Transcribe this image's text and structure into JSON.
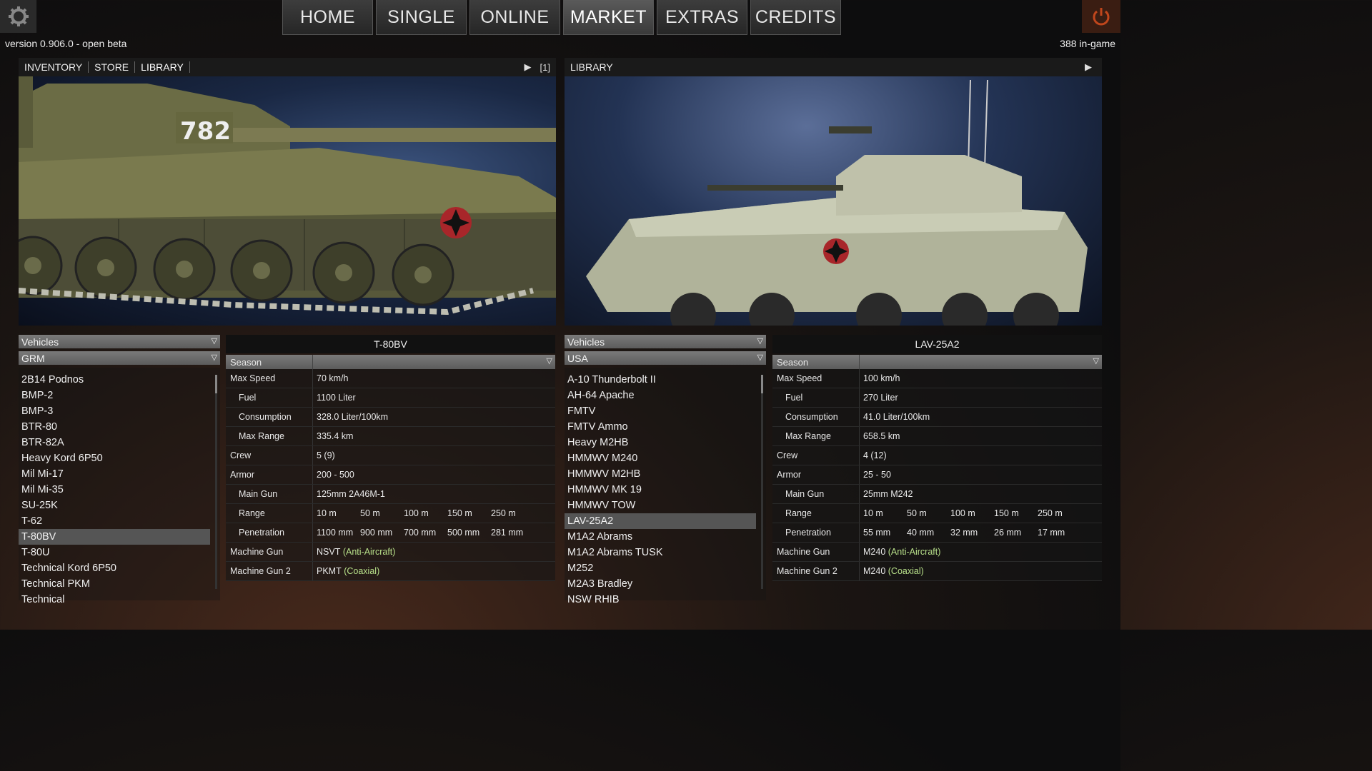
{
  "nav": {
    "tabs": [
      "HOME",
      "SINGLE",
      "ONLINE",
      "MARKET",
      "EXTRAS",
      "CREDITS"
    ],
    "active": "MARKET"
  },
  "version": "version 0.906.0 - open beta",
  "ingame_count": "388 in-game",
  "left_panel": {
    "tabs": [
      "INVENTORY",
      "STORE",
      "LIBRARY"
    ],
    "count": "[1]",
    "turret_number": "782",
    "category": "Vehicles",
    "faction": "GRM",
    "vehicles": [
      "2B14 Podnos",
      "BMP-2",
      "BMP-3",
      "BTR-80",
      "BTR-82A",
      "Heavy Kord 6P50",
      "Mil Mi-17",
      "Mil Mi-35",
      "SU-25K",
      "T-62",
      "T-80BV",
      "T-80U",
      "Technical Kord 6P50",
      "Technical PKM",
      "Technical"
    ],
    "selected": "T-80BV",
    "stats": {
      "title": "T-80BV",
      "season": "Season",
      "max_speed_label": "Max Speed",
      "max_speed": "70 km/h",
      "fuel_label": "Fuel",
      "fuel": "1100 Liter",
      "consumption_label": "Consumption",
      "consumption": "328.0 Liter/100km",
      "max_range_label": "Max Range",
      "max_range": "335.4 km",
      "crew_label": "Crew",
      "crew": "5 (9)",
      "armor_label": "Armor",
      "armor": "200 - 500",
      "main_gun_label": "Main Gun",
      "main_gun": "125mm 2A46M-1",
      "range_label": "Range",
      "ranges": [
        "10 m",
        "50 m",
        "100 m",
        "150 m",
        "250 m"
      ],
      "penetration_label": "Penetration",
      "penetrations": [
        "1100 mm",
        "900 mm",
        "700 mm",
        "500 mm",
        "281 mm"
      ],
      "mg_label": "Machine Gun",
      "mg_name": "NSVT",
      "mg_type": "(Anti-Aircraft)",
      "mg2_label": "Machine Gun 2",
      "mg2_name": "PKMT",
      "mg2_type": "(Coaxial)"
    }
  },
  "right_panel": {
    "tabs": [
      "LIBRARY"
    ],
    "category": "Vehicles",
    "faction": "USA",
    "vehicles": [
      "A-10 Thunderbolt II",
      "AH-64 Apache",
      "FMTV",
      "FMTV Ammo",
      "Heavy M2HB",
      "HMMWV M240",
      "HMMWV M2HB",
      "HMMWV MK 19",
      "HMMWV TOW",
      "LAV-25A2",
      "M1A2 Abrams",
      "M1A2 Abrams TUSK",
      "M252",
      "M2A3 Bradley",
      "NSW RHIB"
    ],
    "selected": "LAV-25A2",
    "stats": {
      "title": "LAV-25A2",
      "season": "Season",
      "max_speed_label": "Max Speed",
      "max_speed": "100 km/h",
      "fuel_label": "Fuel",
      "fuel": "270 Liter",
      "consumption_label": "Consumption",
      "consumption": "41.0 Liter/100km",
      "max_range_label": "Max Range",
      "max_range": "658.5 km",
      "crew_label": "Crew",
      "crew": "4 (12)",
      "armor_label": "Armor",
      "armor": "25 - 50",
      "main_gun_label": "Main Gun",
      "main_gun": "25mm M242",
      "range_label": "Range",
      "ranges": [
        "10 m",
        "50 m",
        "100 m",
        "150 m",
        "250 m"
      ],
      "penetration_label": "Penetration",
      "penetrations": [
        "55 mm",
        "40 mm",
        "32 mm",
        "26 mm",
        "17 mm"
      ],
      "mg_label": "Machine Gun",
      "mg_name": "M240",
      "mg_type": "(Anti-Aircraft)",
      "mg2_label": "Machine Gun 2",
      "mg2_name": "M240",
      "mg2_type": "(Coaxial)"
    }
  },
  "icons": {
    "settings": "gear-icon",
    "quit": "power-icon",
    "play": "play-icon",
    "dropdown": "chevron-down-icon",
    "insignia": "iron-cross-icon"
  },
  "colors": {
    "accent_green": "#b8e08a",
    "power": "#c0461c"
  }
}
